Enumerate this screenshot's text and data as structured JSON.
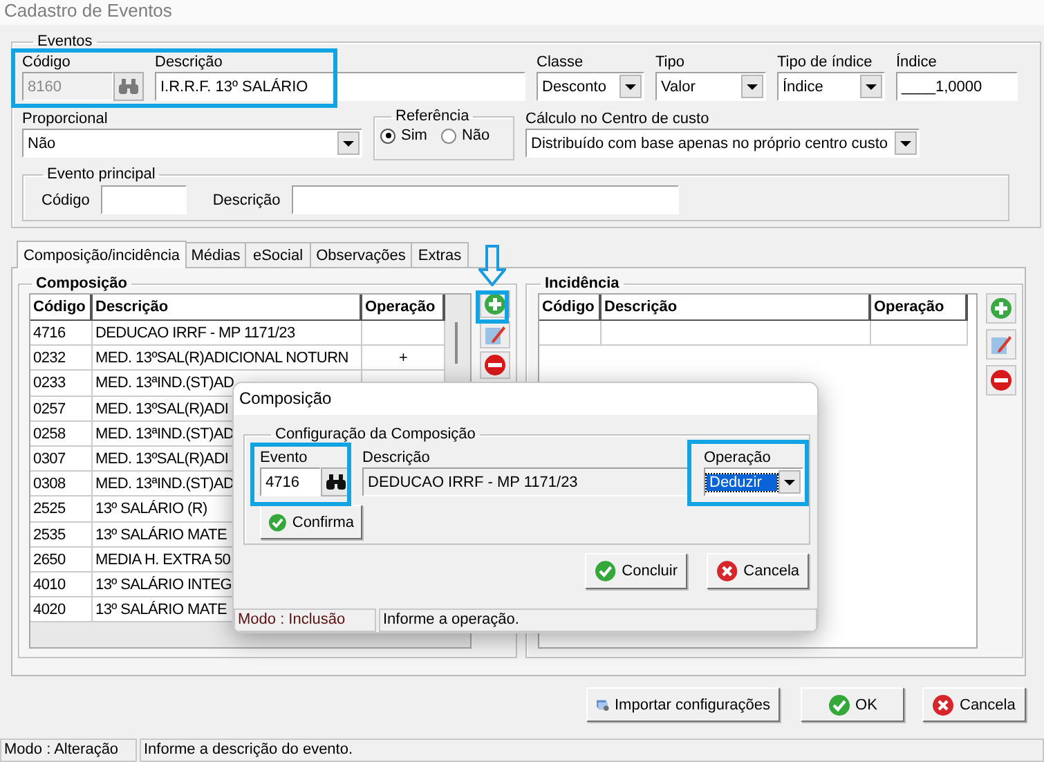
{
  "window": {
    "title": "Cadastro de Eventos"
  },
  "eventos": {
    "legend": "Eventos",
    "codigo": {
      "label": "Código",
      "value": "8160",
      "disabled": true
    },
    "descricao": {
      "label": "Descrição",
      "value": "I.R.R.F. 13º SALÁRIO"
    },
    "classe": {
      "label": "Classe",
      "value": "Desconto"
    },
    "tipo": {
      "label": "Tipo",
      "value": "Valor"
    },
    "tipo_indice": {
      "label": "Tipo de índice",
      "value": "Índice"
    },
    "indice": {
      "label": "Índice",
      "value": "____1,0000"
    },
    "proporcional": {
      "label": "Proporcional",
      "value": "Não"
    },
    "referencia": {
      "legend": "Referência",
      "options": [
        {
          "label": "Sim",
          "selected": true
        },
        {
          "label": "Não",
          "selected": false
        }
      ]
    },
    "calculo_centro_custo": {
      "label": "Cálculo no Centro de custo",
      "value": "Distribuído com base apenas no próprio centro custo"
    },
    "evento_principal": {
      "legend": "Evento principal",
      "codigo_label": "Código",
      "descricao_label": "Descrição"
    }
  },
  "tabs": [
    {
      "label": "Composição/incidência",
      "selected": true
    },
    {
      "label": "Médias",
      "selected": false
    },
    {
      "label": "eSocial",
      "selected": false
    },
    {
      "label": "Observações",
      "selected": false
    },
    {
      "label": "Extras",
      "selected": false
    }
  ],
  "composicao": {
    "legend": "Composição",
    "columns": [
      "Código",
      "Descrição",
      "Operação"
    ],
    "rows": [
      {
        "codigo": "4716",
        "descricao": "DEDUCAO IRRF - MP 1171/23"
      },
      {
        "codigo": "0232",
        "descricao": "MED. 13ºSAL(R)ADICIONAL NOTURN",
        "operacao": "+"
      },
      {
        "codigo": "0233",
        "descricao": "MED. 13ªIND.(ST)AD"
      },
      {
        "codigo": "0257",
        "descricao": "MED. 13ºSAL(R)ADI"
      },
      {
        "codigo": "0258",
        "descricao": "MED. 13ªIND.(ST)AD"
      },
      {
        "codigo": "0307",
        "descricao": "MED. 13ºSAL(R)ADI"
      },
      {
        "codigo": "0308",
        "descricao": "MED. 13ªIND.(ST)AD"
      },
      {
        "codigo": "2525",
        "descricao": "13º SALÁRIO (R)"
      },
      {
        "codigo": "2535",
        "descricao": "13º SALÁRIO MATE"
      },
      {
        "codigo": "2650",
        "descricao": "MEDIA H. EXTRA 50"
      },
      {
        "codigo": "4010",
        "descricao": "13º SALÁRIO INTEG"
      },
      {
        "codigo": "4020",
        "descricao": "13º SALÁRIO MATE"
      }
    ]
  },
  "incidencia": {
    "legend": "Incidência",
    "columns": [
      "Código",
      "Descrição",
      "Operação"
    ]
  },
  "buttons": [
    {
      "label": "Importar configurações",
      "kind": "import"
    },
    {
      "label": "OK",
      "kind": "ok"
    },
    {
      "label": "Cancela",
      "kind": "cancel"
    }
  ],
  "status_bar": {
    "mode": "Modo : Alteração",
    "message": "Informe a descrição do evento."
  },
  "dialog": {
    "title": "Composição",
    "legend": "Configuração da Composição",
    "evento": {
      "label": "Evento",
      "value": "4716"
    },
    "descricao": {
      "label": "Descrição",
      "value": "DEDUCAO IRRF - MP 1171/23"
    },
    "operacao": {
      "label": "Operação",
      "value": "Deduzir"
    },
    "confirm_button": "Confirma",
    "buttons": [
      {
        "label": "Concluir",
        "kind": "ok"
      },
      {
        "label": "Cancela",
        "kind": "cancel"
      }
    ],
    "status_bar": {
      "mode": "Modo : Inclusão",
      "message": "Informe a operação."
    }
  }
}
